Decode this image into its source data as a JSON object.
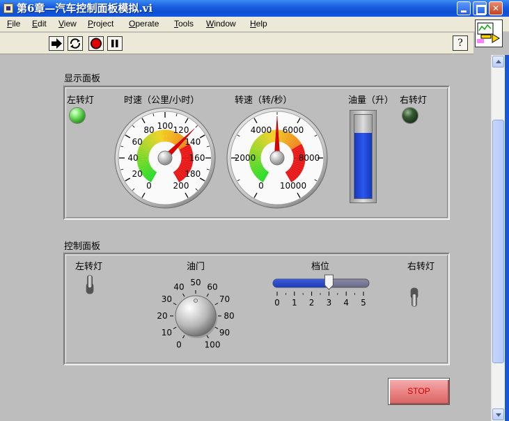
{
  "window": {
    "title": "第6章—汽车控制面板模拟.vi"
  },
  "menu": [
    {
      "label": "File",
      "mnemonic": "F",
      "rest": "ile"
    },
    {
      "label": "Edit",
      "mnemonic": "E",
      "rest": "dit"
    },
    {
      "label": "View",
      "mnemonic": "V",
      "rest": "iew"
    },
    {
      "label": "Project",
      "mnemonic": "P",
      "rest": "roject"
    },
    {
      "label": "Operate",
      "mnemonic": "O",
      "rest": "perate"
    },
    {
      "label": "Tools",
      "mnemonic": "T",
      "rest": "ools"
    },
    {
      "label": "Window",
      "mnemonic": "W",
      "rest": "indow"
    },
    {
      "label": "Help",
      "mnemonic": "H",
      "rest": "elp"
    }
  ],
  "toolbar": {
    "help_label": "?",
    "icons": [
      "run-arrow-icon",
      "run-continuous-icon",
      "abort-icon",
      "pause-icon"
    ]
  },
  "display_panel": {
    "title": "显示面板",
    "left_turn_label": "左转灯",
    "left_turn_on": true,
    "right_turn_label": "右转灯",
    "right_turn_on": false,
    "speed_label": "时速（公里/小时）",
    "speed_ticks": [
      "0",
      "20",
      "40",
      "60",
      "80",
      "100",
      "120",
      "140",
      "160",
      "180",
      "200"
    ],
    "speed_max": 200,
    "speed_value": 130,
    "rpm_label": "转速（转/秒）",
    "rpm_ticks": [
      "0",
      "2000",
      "4000",
      "6000",
      "8000",
      "10000"
    ],
    "rpm_max": 10000,
    "rpm_value": 5000,
    "fuel_label": "油量（升）",
    "fuel_fraction": 0.78
  },
  "control_panel": {
    "title": "控制面板",
    "left_turn_label": "左转灯",
    "right_turn_label": "右转灯",
    "throttle_label": "油门",
    "throttle_ticks": [
      "0",
      "10",
      "20",
      "30",
      "40",
      "50",
      "60",
      "70",
      "80",
      "90",
      "100"
    ],
    "throttle_value": 50,
    "gear_label": "档位",
    "gear_ticks": [
      "0",
      "1",
      "2",
      "3",
      "4",
      "5"
    ],
    "gear_value": 3,
    "gear_max": 5,
    "stop_label": "STOP"
  }
}
